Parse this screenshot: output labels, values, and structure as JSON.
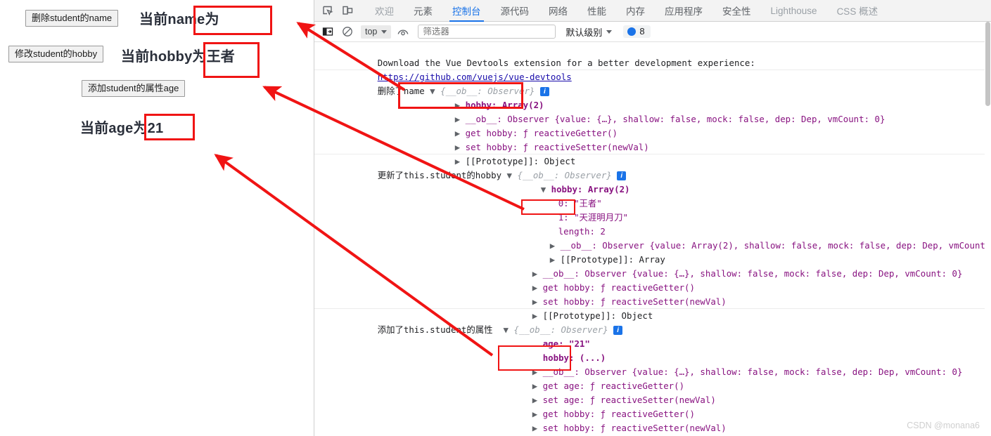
{
  "page": {
    "buttons": [
      {
        "name": "delete-name-button",
        "label": "删除student的name"
      },
      {
        "name": "modify-hobby-button",
        "label": "修改student的hobby"
      },
      {
        "name": "add-age-button",
        "label": "添加student的属性age"
      }
    ],
    "labels": [
      {
        "name": "current-name-label",
        "text": "当前name为",
        "value": ""
      },
      {
        "name": "current-hobby-label",
        "text": "当前hobby为",
        "value": "王者"
      },
      {
        "name": "current-age-label",
        "text": "当前age为",
        "value": "21"
      }
    ]
  },
  "devtools": {
    "icons": {
      "inspect": "inspect-element-icon",
      "device": "device-toolbar-icon"
    },
    "tabs": [
      {
        "label": "欢迎",
        "active": false,
        "dim": true
      },
      {
        "label": "元素",
        "active": false,
        "dim": false
      },
      {
        "label": "控制台",
        "active": true,
        "dim": false
      },
      {
        "label": "源代码",
        "active": false,
        "dim": false
      },
      {
        "label": "网络",
        "active": false,
        "dim": false
      },
      {
        "label": "性能",
        "active": false,
        "dim": false
      },
      {
        "label": "内存",
        "active": false,
        "dim": false
      },
      {
        "label": "应用程序",
        "active": false,
        "dim": false
      },
      {
        "label": "安全性",
        "active": false,
        "dim": false
      },
      {
        "label": "Lighthouse",
        "active": false,
        "dim": true
      },
      {
        "label": "CSS 概述",
        "active": false,
        "dim": true
      }
    ],
    "filterbar": {
      "context": "top",
      "filter_placeholder": "筛选器",
      "filter_value": "",
      "level": "默认级别",
      "issues_count": "8"
    },
    "console": {
      "banner_line1": "Download the Vue Devtools extension for a better development experience:",
      "banner_link": "https://github.com/vuejs/vue-devtools",
      "groups": [
        {
          "label": "删除了name",
          "header": "{__ob__: Observer}",
          "rows": [
            "hobby: Array(2)",
            "__ob__: Observer {value: {…}, shallow: false, mock: false, dep: Dep, vmCount: 0}",
            "get hobby: ƒ reactiveGetter()",
            "set hobby: ƒ reactiveSetter(newVal)",
            "[[Prototype]]: Object"
          ]
        },
        {
          "label": "更新了this.student的hobby",
          "header": "{__ob__: Observer}",
          "rows": [
            "hobby: Array(2)",
            "0: \"王者\"",
            "1: \"天涯明月刀\"",
            "length: 2",
            "__ob__: Observer {value: Array(2), shallow: false, mock: false, dep: Dep, vmCount",
            "[[Prototype]]: Array",
            "__ob__: Observer {value: {…}, shallow: false, mock: false, dep: Dep, vmCount: 0}",
            "get hobby: ƒ reactiveGetter()",
            "set hobby: ƒ reactiveSetter(newVal)",
            "[[Prototype]]: Object"
          ]
        },
        {
          "label": "添加了this.student的属性",
          "header": "{__ob__: Observer}",
          "rows": [
            "age: \"21\"",
            "hobby: (...)",
            "__ob__: Observer {value: {…}, shallow: false, mock: false, dep: Dep, vmCount: 0}",
            "get age: ƒ reactiveGetter()",
            "set age: ƒ reactiveSetter(newVal)",
            "get hobby: ƒ reactiveGetter()",
            "set hobby: ƒ reactiveSetter(newVal)"
          ]
        }
      ]
    }
  },
  "annotation": {
    "accent_color": "#f01414",
    "boxes": 6,
    "arrows": 3
  },
  "watermark": "CSDN @monana6"
}
